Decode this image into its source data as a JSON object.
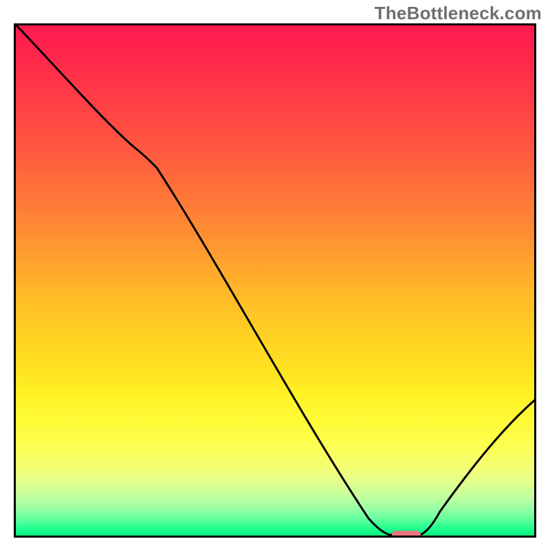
{
  "watermark": "TheBottleneck.com",
  "chart_data": {
    "type": "line",
    "x": [
      0.0,
      0.03,
      0.23,
      0.27,
      0.68,
      0.72,
      0.77,
      0.82,
      1.0
    ],
    "values": [
      100,
      97,
      76,
      72.5,
      3.5,
      0.5,
      0.5,
      5,
      27
    ],
    "title": "",
    "xlabel": "",
    "ylabel": "",
    "xlim": [
      0,
      1
    ],
    "ylim": [
      0,
      100
    ],
    "marker": {
      "x_range": [
        0.72,
        0.78
      ],
      "y": 0.5,
      "color": "#e9757e"
    },
    "background_gradient_stops": [
      {
        "pos": 0.0,
        "color": "#ff1a50"
      },
      {
        "pos": 0.35,
        "color": "#ff7a37"
      },
      {
        "pos": 0.68,
        "color": "#ffe420"
      },
      {
        "pos": 0.92,
        "color": "#c2ff9e"
      },
      {
        "pos": 1.0,
        "color": "#00e878"
      }
    ]
  }
}
